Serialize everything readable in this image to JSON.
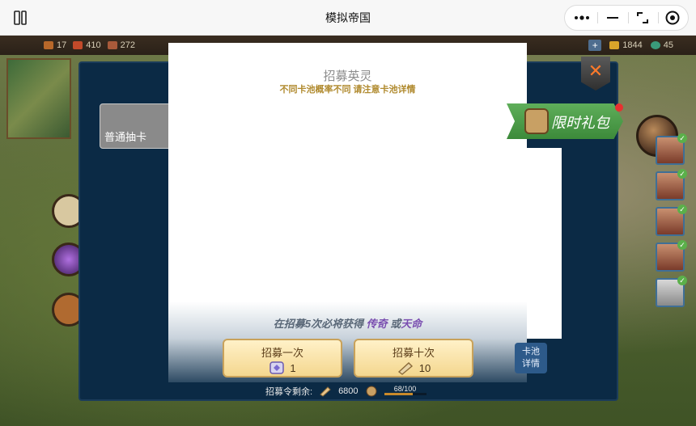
{
  "app": {
    "title": "模拟帝国"
  },
  "resources": {
    "left": [
      "17",
      "410",
      "272"
    ],
    "right": [
      "1844",
      "45"
    ]
  },
  "dialog": {
    "pool_tab_label": "普通抽卡",
    "title": "招募英灵",
    "subtitle": "不同卡池概率不同 请注意卡池详情",
    "guarantee_prefix": "在招募5次必将获得",
    "guarantee_legend": "传奇",
    "guarantee_or": "或",
    "guarantee_fate": "天命",
    "recruit_once": {
      "label": "招募一次",
      "cost": "1"
    },
    "recruit_ten": {
      "label": "招募十次",
      "cost": "10"
    },
    "pool_detail_line1": "卡池",
    "pool_detail_line2": "详情",
    "remaining_label": "招募令剩余:",
    "remaining_value": "6800",
    "progress_text": "68/100",
    "progress_fraction": 0.68
  },
  "gift": {
    "label": "限时礼包"
  },
  "colors": {
    "dialog_bg": "#0b2a45",
    "button_gold": "#f4d78f",
    "accent_purple": "#7a4fb0",
    "gift_green": "#4c9c48"
  }
}
